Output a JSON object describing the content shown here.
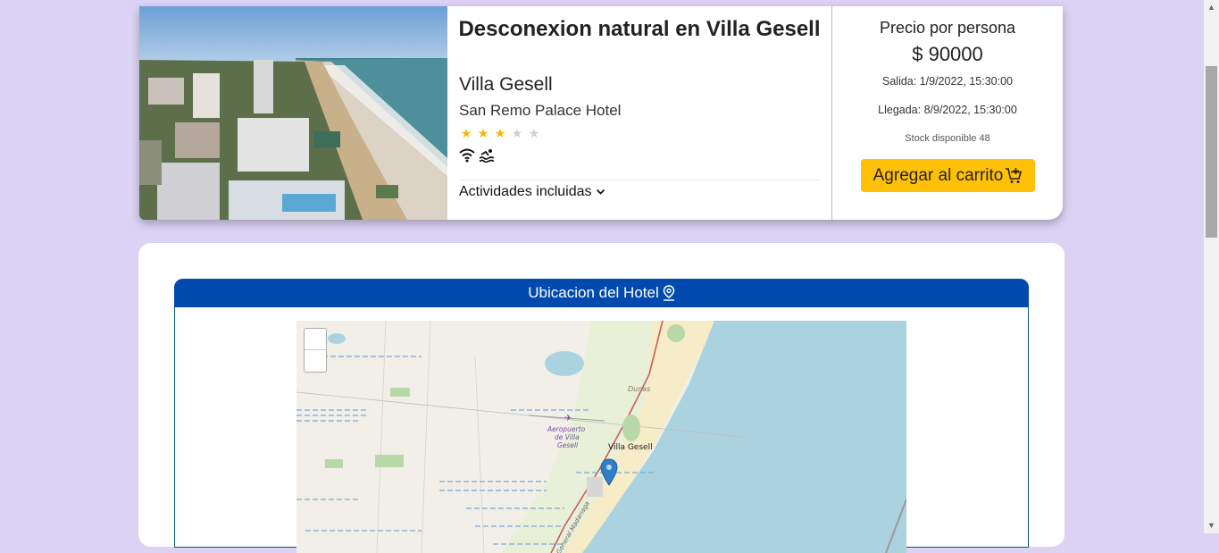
{
  "package": {
    "title": "Desconexion natural en Villa Gesell",
    "city": "Villa Gesell",
    "hotel": "San Remo Palace Hotel",
    "stars": 3,
    "max_stars": 5,
    "amenities": [
      "wifi-icon",
      "pool-icon"
    ],
    "activities_label": "Actividades incluidas"
  },
  "pricing": {
    "label": "Precio por persona",
    "value": "$ 90000",
    "departure": "Salida: 1/9/2022, 15:30:00",
    "arrival": "Llegada: 8/9/2022, 15:30:00",
    "stock": "Stock disponible 48",
    "cart_button": "Agregar al carrito"
  },
  "location": {
    "header": "Ubicacion del Hotel",
    "map_labels": {
      "town": "Villa Gesell",
      "dunes": "Dunas",
      "airport": "Aeropuerto de Villa Gesell",
      "road": "General Madariaga"
    },
    "zoom_in": "+",
    "zoom_out": "−"
  },
  "colors": {
    "background": "#dcd3f4",
    "accent_button": "#ffc107",
    "header_blue": "#004aad",
    "star_on": "#f5b800"
  }
}
